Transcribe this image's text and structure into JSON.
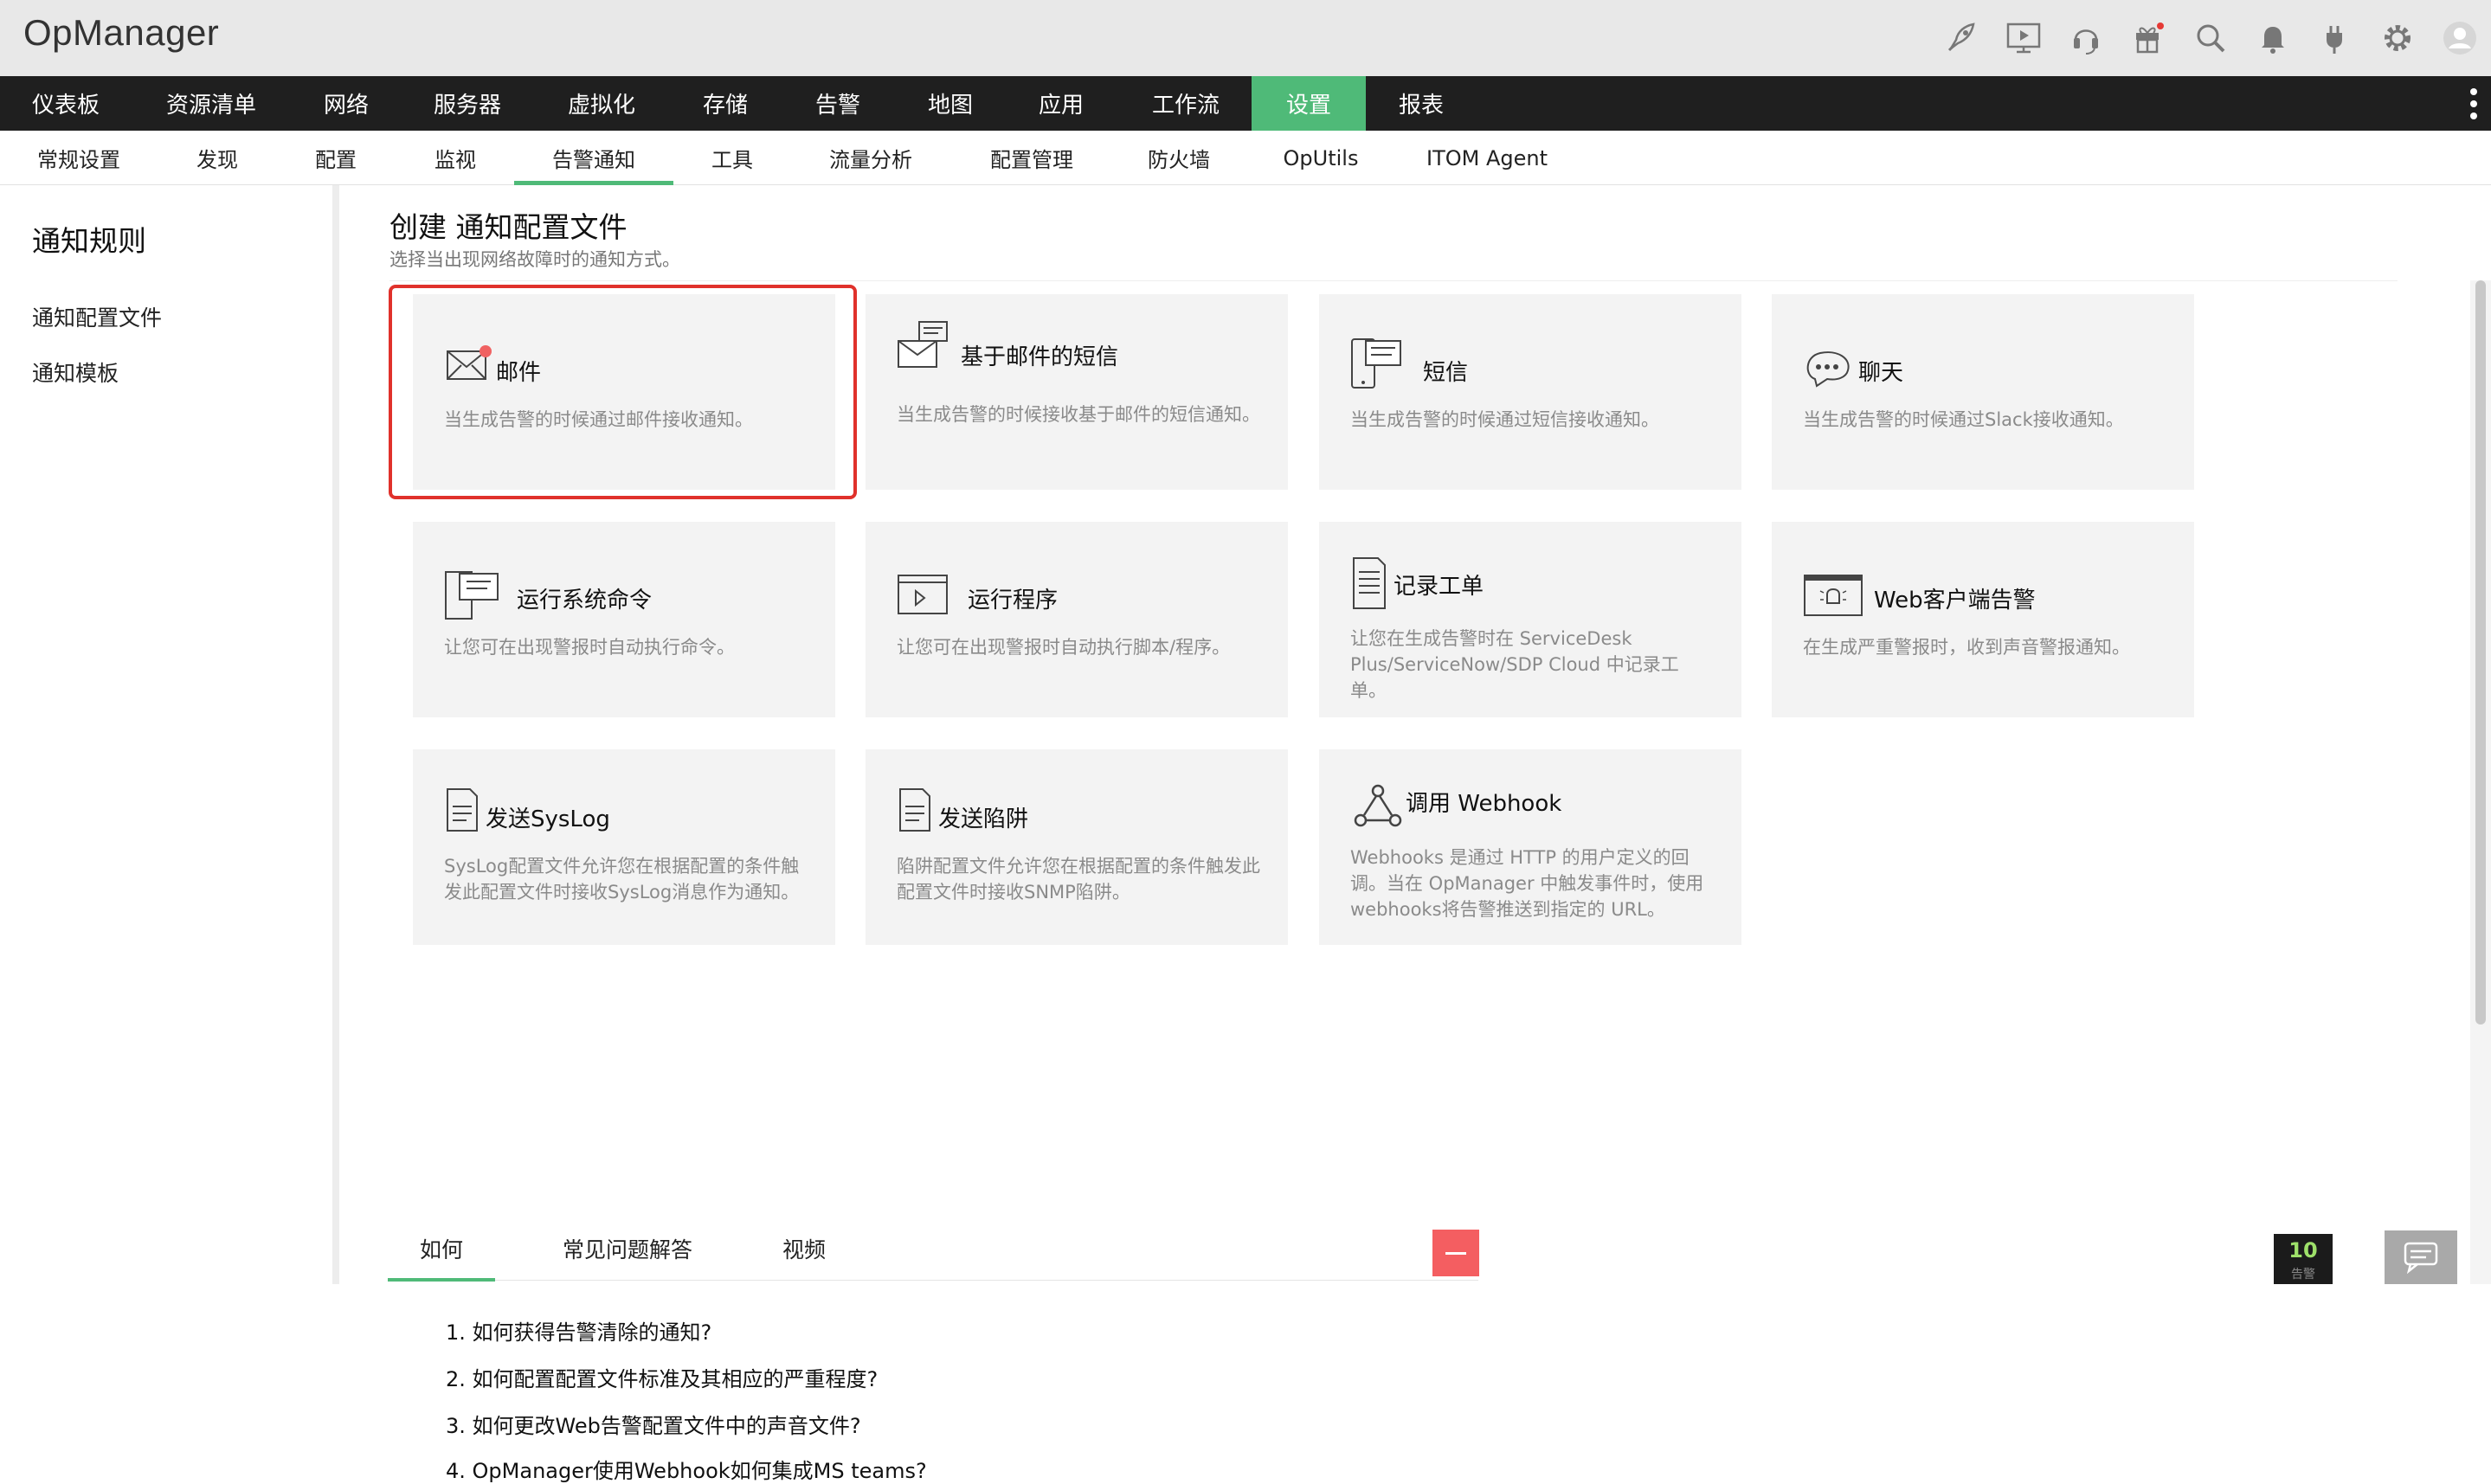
{
  "app": {
    "title": "OpManager"
  },
  "top_icons": [
    {
      "name": "rocket-icon"
    },
    {
      "name": "video-tutorial-icon"
    },
    {
      "name": "support-headset-icon"
    },
    {
      "name": "gift-icon"
    },
    {
      "name": "search-icon"
    },
    {
      "name": "bell-icon"
    },
    {
      "name": "plugin-icon"
    },
    {
      "name": "gear-icon"
    },
    {
      "name": "user-avatar-icon"
    }
  ],
  "main_nav": {
    "items": [
      "仪表板",
      "资源清单",
      "网络",
      "服务器",
      "虚拟化",
      "存储",
      "告警",
      "地图",
      "应用",
      "工作流",
      "设置",
      "报表"
    ],
    "active": "设置"
  },
  "sub_nav": {
    "items": [
      "常规设置",
      "发现",
      "配置",
      "监视",
      "告警通知",
      "工具",
      "流量分析",
      "配置管理",
      "防火墙",
      "OpUtils",
      "ITOM Agent"
    ],
    "active": "告警通知"
  },
  "left_panel": {
    "title": "通知规则",
    "links": [
      "通知配置文件",
      "通知模板"
    ]
  },
  "main": {
    "title": "创建 通知配置文件",
    "subtitle": "选择当出现网络故障时的通知方式。",
    "cards": [
      {
        "icon": "email-icon",
        "title": "邮件",
        "desc": "当生成告警的时候通过邮件接收通知。"
      },
      {
        "icon": "sms-based-email-icon",
        "title": "基于邮件的短信",
        "desc": "当生成告警的时候接收基于邮件的短信通知。"
      },
      {
        "icon": "sms-icon",
        "title": "短信",
        "desc": "当生成告警的时候通过短信接收通知。"
      },
      {
        "icon": "chat-icon",
        "title": "聊天",
        "desc": "当生成告警的时候通过Slack接收通知。"
      },
      {
        "icon": "run-command-icon",
        "title": "运行系统命令",
        "desc": "让您可在出现警报时自动执行命令。"
      },
      {
        "icon": "run-program-icon",
        "title": "运行程序",
        "desc": "让您可在出现警报时自动执行脚本/程序。"
      },
      {
        "icon": "log-ticket-icon",
        "title": "记录工单",
        "desc": "让您在生成告警时在 ServiceDesk Plus/ServiceNow/SDP Cloud 中记录工单。"
      },
      {
        "icon": "web-alarm-icon",
        "title": "Web客户端告警",
        "desc": "在生成严重警报时，收到声音警报通知。"
      },
      {
        "icon": "syslog-icon",
        "title": "发送SysLog",
        "desc": "SysLog配置文件允许您在根据配置的条件触发此配置文件时接收SysLog消息作为通知。"
      },
      {
        "icon": "trap-icon",
        "title": "发送陷阱",
        "desc": "陷阱配置文件允许您在根据配置的条件触发此配置文件时接收SNMP陷阱。"
      },
      {
        "icon": "webhook-icon",
        "title": "调用 Webhook",
        "desc": "Webhooks 是通过 HTTP 的用户定义的回调。当在 OpManager 中触发事件时，使用 webhooks将告警推送到指定的 URL。"
      }
    ]
  },
  "help": {
    "tabs": [
      "如何",
      "常见问题解答",
      "视频"
    ],
    "active_tab": "如何",
    "faq": [
      "1. 如何获得告警清除的通知?",
      "2. 如何配置配置文件标准及其相应的严重程度?",
      "3. 如何更改Web告警配置文件中的声音文件?",
      "4. OpManager使用Webhook如何集成MS teams?"
    ]
  },
  "alarm_badge": {
    "count": "10",
    "label": "告警"
  },
  "colors": {
    "accent": "#4fba78",
    "selection": "#e0312b",
    "nav_bg": "#1f1f1f",
    "collapse": "#f45e61"
  }
}
